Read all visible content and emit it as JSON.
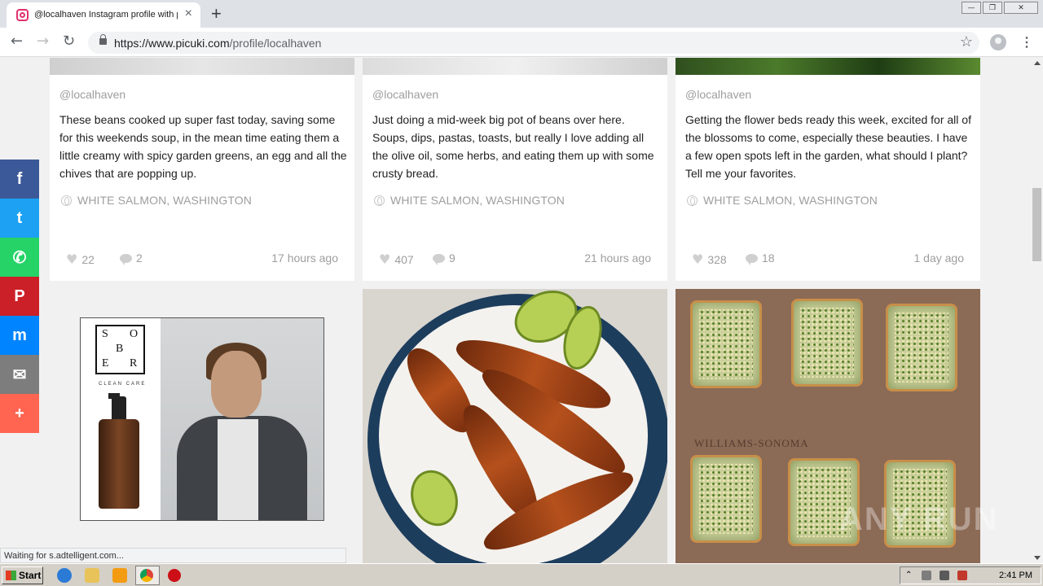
{
  "browser": {
    "tab_title": "@localhaven Instagram profile with p",
    "tab_close": "×",
    "new_tab": "+",
    "url_host": "https://www.picuki.com",
    "url_path": "/profile/localhaven",
    "back": "←",
    "forward": "→",
    "reload": "↻",
    "star": "☆",
    "menu": "⋮",
    "window_buttons": [
      "—",
      "❐",
      "✕"
    ]
  },
  "posts": [
    {
      "username": "@localhaven",
      "caption": "These beans cooked up super fast today, saving some for this weekends soup, in the mean time eating them a little creamy with spicy garden greens, an egg and all the chives that are popping up.",
      "location": "WHITE SALMON, WASHINGTON",
      "likes": "22",
      "comments": "2",
      "time": "17 hours ago"
    },
    {
      "username": "@localhaven",
      "caption": "Just doing a mid-week big pot of beans over here. Soups, dips, pastas, toasts, but really I love adding all the olive oil, some herbs, and eating them up with some crusty bread.",
      "location": "WHITE SALMON, WASHINGTON",
      "likes": "407",
      "comments": "9",
      "time": "21 hours ago"
    },
    {
      "username": "@localhaven",
      "caption": "Getting the flower beds ready this week, excited for all of the blossoms to come, especially these beauties. I have a few open spots left in the garden, what should I plant? Tell me your favorites.",
      "location": "WHITE SALMON, WASHINGTON",
      "likes": "328",
      "comments": "18",
      "time": "1 day ago"
    }
  ],
  "ad": {
    "brand_letters": [
      "S",
      "O",
      "B",
      "E",
      "R"
    ],
    "tagline": "CLEAN CARE"
  },
  "photo_watermark": "WILLIAMS-SONOMA",
  "overlay_watermark": "ANY RUN",
  "share": [
    {
      "name": "facebook",
      "glyph": "f",
      "color": "#3b5998"
    },
    {
      "name": "twitter",
      "glyph": "t",
      "color": "#1da1f2"
    },
    {
      "name": "whatsapp",
      "glyph": "✆",
      "color": "#25d366"
    },
    {
      "name": "pinterest",
      "glyph": "P",
      "color": "#cb2027"
    },
    {
      "name": "messenger",
      "glyph": "m",
      "color": "#0084ff"
    },
    {
      "name": "email",
      "glyph": "✉",
      "color": "#7d7d7d"
    },
    {
      "name": "more",
      "glyph": "+",
      "color": "#ff6550"
    }
  ],
  "status_text": "Waiting for s.adtelligent.com...",
  "taskbar": {
    "start_label": "Start",
    "clock": "2:41 PM"
  }
}
